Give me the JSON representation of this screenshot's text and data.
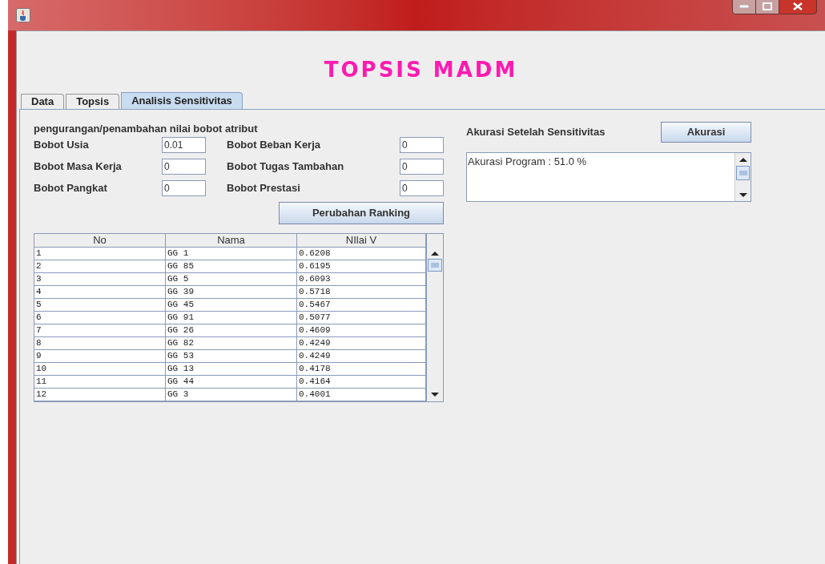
{
  "app_title": "TOPSIS MADM",
  "tabs": [
    {
      "label": "Data",
      "selected": false
    },
    {
      "label": "Topsis",
      "selected": false
    },
    {
      "label": "Analisis Sensitivitas",
      "selected": true
    }
  ],
  "weights": {
    "heading": "pengurangan/penambahan nilai bobot atribut",
    "fields": [
      {
        "label": "Bobot Usia",
        "value": "0.01"
      },
      {
        "label": "Bobot Beban Kerja",
        "value": "0"
      },
      {
        "label": "Bobot Masa Kerja",
        "value": "0"
      },
      {
        "label": "Bobot Tugas Tambahan",
        "value": "0"
      },
      {
        "label": "Bobot Pangkat",
        "value": "0"
      },
      {
        "label": "Bobot Prestasi",
        "value": "0"
      }
    ],
    "button": "Perubahan Ranking"
  },
  "table": {
    "columns": [
      "No",
      "Nama",
      "NIlai V"
    ],
    "rows": [
      [
        "1",
        "GG 1",
        "0.6208"
      ],
      [
        "2",
        "GG 85",
        "0.6195"
      ],
      [
        "3",
        "GG 5",
        "0.6093"
      ],
      [
        "4",
        "GG 39",
        "0.5718"
      ],
      [
        "5",
        "GG 45",
        "0.5467"
      ],
      [
        "6",
        "GG 91",
        "0.5077"
      ],
      [
        "7",
        "GG 26",
        "0.4609"
      ],
      [
        "8",
        "GG 82",
        "0.4249"
      ],
      [
        "9",
        "GG 53",
        "0.4249"
      ],
      [
        "10",
        "GG 13",
        "0.4178"
      ],
      [
        "11",
        "GG 44",
        "0.4164"
      ],
      [
        "12",
        "GG 3",
        "0.4001"
      ]
    ]
  },
  "accuracy": {
    "label": "Akurasi Setelah Sensitivitas",
    "button": "Akurasi",
    "output": "Akurasi Program : 51.0 %"
  }
}
